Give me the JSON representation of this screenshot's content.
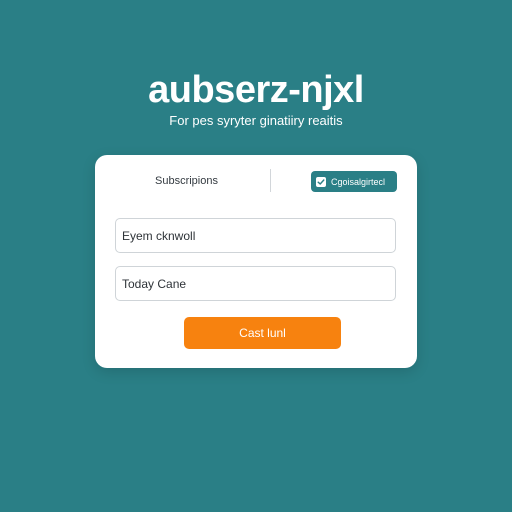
{
  "brand": {
    "title": "aubserz-njxl",
    "tagline": "For pes syryter ginatiiry reaitis"
  },
  "card": {
    "header_label": "Subscripions",
    "badge_label": "Cgoisalgirtecl",
    "badge_icon": "check-icon",
    "fields": [
      {
        "value": "Eyem cknwoll",
        "placeholder": ""
      },
      {
        "value": "Today Cane",
        "placeholder": ""
      }
    ],
    "submit_label": "Cast lunl"
  },
  "colors": {
    "background": "#2a7f86",
    "card": "#ffffff",
    "accent": "#f7820f",
    "badge": "#2a7f86"
  }
}
